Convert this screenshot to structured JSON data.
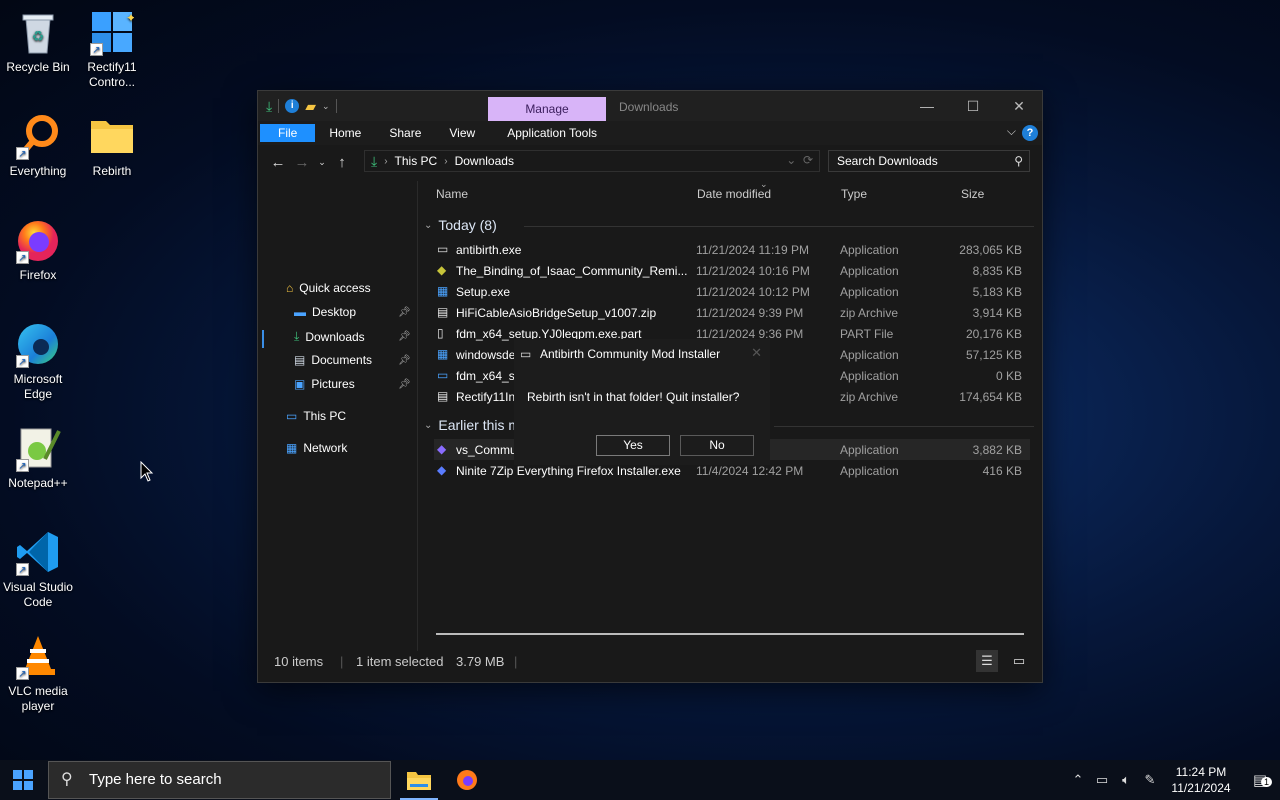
{
  "desktop": {
    "icons": [
      {
        "label": "Recycle Bin",
        "icon": "recycle-bin-icon"
      },
      {
        "label": "Rectify11 Contro...",
        "icon": "control-panel-icon"
      },
      {
        "label": "Everything",
        "icon": "everything-search-icon"
      },
      {
        "label": "Rebirth",
        "icon": "folder-icon"
      },
      {
        "label": "Firefox",
        "icon": "firefox-icon"
      },
      {
        "label": "Microsoft Edge",
        "icon": "edge-icon"
      },
      {
        "label": "Notepad++",
        "icon": "notepad-plus-plus-icon"
      },
      {
        "label": "Visual Studio Code",
        "icon": "vscode-icon"
      },
      {
        "label": "VLC media player",
        "icon": "vlc-icon"
      }
    ]
  },
  "explorer": {
    "manage_tab": "Manage",
    "title": "Downloads",
    "ribbon": {
      "file": "File",
      "home": "Home",
      "share": "Share",
      "view": "View",
      "app_tools": "Application Tools"
    },
    "address": {
      "crumbs": [
        "This PC",
        "Downloads"
      ]
    },
    "search": {
      "placeholder": "Search Downloads"
    },
    "nav": {
      "quick_access": "Quick access",
      "desktop": "Desktop",
      "downloads": "Downloads",
      "documents": "Documents",
      "pictures": "Pictures",
      "this_pc": "This PC",
      "network": "Network"
    },
    "columns": {
      "name": "Name",
      "date": "Date modified",
      "type": "Type",
      "size": "Size"
    },
    "groups": {
      "today": "Today (8)",
      "earlier": "Earlier this m"
    },
    "today_files": [
      {
        "name": "antibirth.exe",
        "date": "11/21/2024 11:19 PM",
        "type": "Application",
        "size": "283,065 KB"
      },
      {
        "name": "The_Binding_of_Isaac_Community_Remi...",
        "date": "11/21/2024 10:16 PM",
        "type": "Application",
        "size": "8,835 KB"
      },
      {
        "name": "Setup.exe",
        "date": "11/21/2024 10:12 PM",
        "type": "Application",
        "size": "5,183 KB"
      },
      {
        "name": "HiFiCableAsioBridgeSetup_v1007.zip",
        "date": "11/21/2024 9:39 PM",
        "type": "zip Archive",
        "size": "3,914 KB"
      },
      {
        "name": "fdm_x64_setup.YJ0leqpm.exe.part",
        "date": "11/21/2024 9:36 PM",
        "type": "PART File",
        "size": "20,176 KB"
      },
      {
        "name": "windowsde",
        "date": "7 PM",
        "type": "Application",
        "size": "57,125 KB"
      },
      {
        "name": "fdm_x64_se",
        "date": "6 PM",
        "type": "Application",
        "size": "0 KB"
      },
      {
        "name": "Rectify11In",
        "date": "4 PM",
        "type": "zip Archive",
        "size": "174,654 KB"
      }
    ],
    "earlier_files": [
      {
        "name": "vs_Commu",
        "date": "7 PM",
        "type": "Application",
        "size": "3,882 KB"
      },
      {
        "name": "Ninite 7Zip Everything Firefox Installer.exe",
        "date": "11/4/2024 12:42 PM",
        "type": "Application",
        "size": "416 KB"
      }
    ],
    "status": {
      "items": "10 items",
      "selected": "1 item selected",
      "selected_size": "3.79 MB"
    }
  },
  "dialog": {
    "title": "Antibirth Community Mod Installer",
    "message": "Rebirth isn't in that folder! Quit installer?",
    "yes": "Yes",
    "no": "No"
  },
  "taskbar": {
    "search_placeholder": "Type here to search",
    "time": "11:24 PM",
    "date": "11/21/2024",
    "notification_count": "1"
  },
  "colors": {
    "accent": "#1e90ff",
    "manage_tab": "#d8b4f8",
    "window_bg": "#191919"
  }
}
